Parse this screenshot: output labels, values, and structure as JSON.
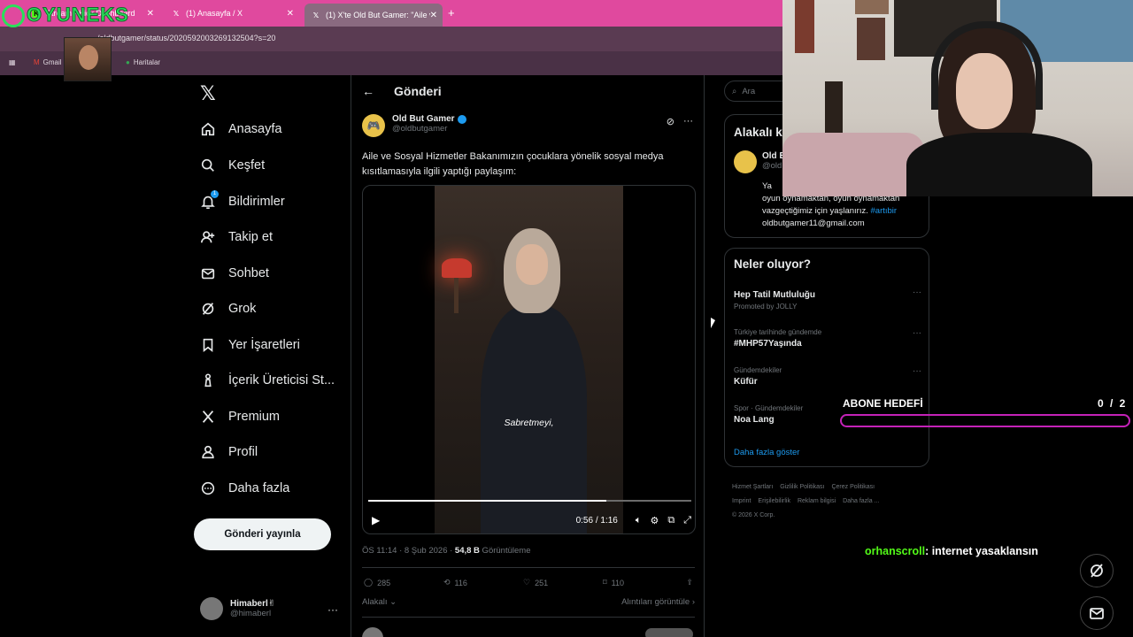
{
  "browser": {
    "tabs": [
      {
        "label": "Stream - Kick Dashboard",
        "icon": "kick-icon"
      },
      {
        "label": "(1) Anasayfa / X",
        "icon": "x-icon"
      },
      {
        "label": "(1) X'te Old But Gamer: \"Aile ve",
        "icon": "x-icon",
        "active": true
      }
    ],
    "address": "/oldbutgamer/status/2020592003269132504?s=20",
    "bookmarks": [
      "Gmail",
      "Haritalar"
    ]
  },
  "overlay": {
    "logo_text": "OYUNEKS",
    "goal_label": "ABONE HEDEFİ",
    "goal_count": "0 / 2",
    "goal_progress": 0,
    "chat_user": "orhanscroll",
    "chat_text": ": internet yasaklansın"
  },
  "nav": {
    "items": [
      {
        "label": "Anasayfa",
        "icon": "home-icon"
      },
      {
        "label": "Keşfet",
        "icon": "search-icon"
      },
      {
        "label": "Bildirimler",
        "icon": "bell-icon",
        "badge": "1"
      },
      {
        "label": "Takip et",
        "icon": "follow-icon"
      },
      {
        "label": "Sohbet",
        "icon": "mail-icon"
      },
      {
        "label": "Grok",
        "icon": "grok-icon"
      },
      {
        "label": "Yer İşaretleri",
        "icon": "bookmark-icon"
      },
      {
        "label": "İçerik Üreticisi St...",
        "icon": "creator-icon"
      },
      {
        "label": "Premium",
        "icon": "x-icon"
      },
      {
        "label": "Profil",
        "icon": "person-icon"
      },
      {
        "label": "Daha fazla",
        "icon": "more-icon"
      }
    ],
    "post_button": "Gönderi yayınla",
    "user": {
      "name": "Himaberl✌",
      "handle": "@himaberl"
    }
  },
  "post": {
    "header": "Gönderi",
    "author": "Old But Gamer",
    "handle": "@oldbutgamer",
    "text": "Aile ve Sosyal Hizmetler Bakanımızın çocuklara yönelik sosyal medya kısıtlamasıyla ilgili yaptığı paylaşım:",
    "video": {
      "subtitle": "Sabretmeyi,",
      "time": "0:56 / 1:16",
      "progress": 0.737
    },
    "time": "ÖS 11:14 · 8 Şub 2026 · ",
    "views_value": "54,8 B",
    "views_label": " Görüntüleme",
    "replies": "285",
    "reposts": "116",
    "likes": "251",
    "bookmarks": "110",
    "relevance_label": "Alakalı",
    "quotes_label": "Alıntıları görüntüle"
  },
  "sidebar": {
    "search_placeholder": "Ara",
    "related_title": "Alakalı k",
    "related_name": "Old B",
    "related_handle": "@old",
    "related_bio_1": "Ya",
    "related_bio_2": "oyun oynamaktan, oyun oynamaktan",
    "related_bio_3": "vazgeçtiğimiz için yaşlanırız.",
    "related_bio_tag": "#artıbir",
    "related_bio_email": "oldbutgamer11@gmail.com",
    "trends_title": "Neler oluyor?",
    "trends": [
      {
        "category": "",
        "title": "Hep Tatil Mutluluğu",
        "promoted": "Promoted by JOLLY"
      },
      {
        "category": "Türkiye tarihinde gündemde",
        "title": "#MHP57Yaşında"
      },
      {
        "category": "Gündemdekiler",
        "title": "Küfür"
      },
      {
        "category": "Spor · Gündemdekiler",
        "title": "Noa Lang"
      }
    ],
    "show_more": "Daha fazla göster",
    "footer": [
      "Hizmet Şartları",
      "Gizlilik Politikası",
      "Çerez Politikası",
      "Imprint",
      "Erişilebilirlik",
      "Reklam bilgisi",
      "Daha fazla ...",
      "© 2026 X Corp."
    ]
  },
  "colors": {
    "tabbar": "#e0499e",
    "accent_blue": "#1d9bf0",
    "kick_green": "#53fc18",
    "goal_border": "#c422b8"
  }
}
